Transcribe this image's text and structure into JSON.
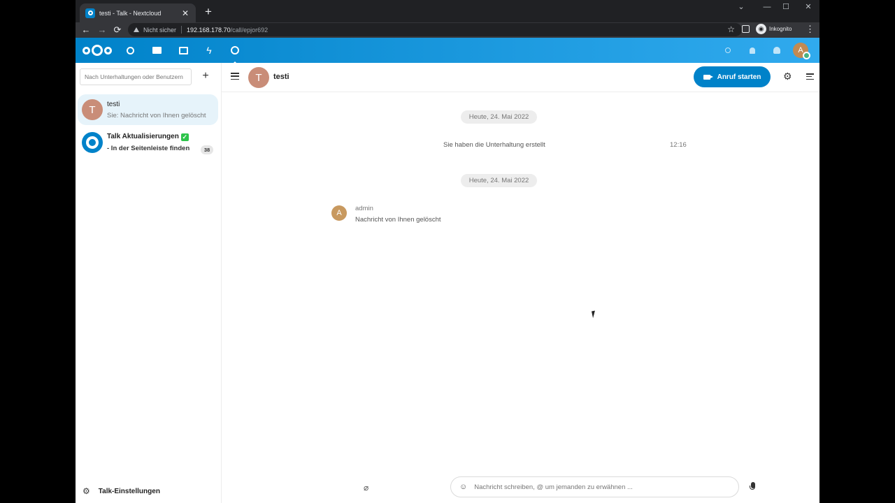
{
  "browser": {
    "tab_title": "testi - Talk - Nextcloud",
    "tab_close": "✕",
    "new_tab": "+",
    "window_controls": [
      "⌄",
      "—",
      "☐",
      "✕"
    ],
    "security_label": "Nicht sicher",
    "url_host": "192.168.178.70",
    "url_path": "/call/epjor692",
    "incognito_label": "Inkognito",
    "nav": {
      "back": "←",
      "forward": "→",
      "reload": "⟳"
    }
  },
  "header": {
    "apps": [
      "dashboard-icon",
      "files-icon",
      "photos-icon",
      "activity-icon",
      "talk-icon"
    ],
    "right": [
      "search-icon",
      "notifications-icon",
      "contacts-icon"
    ],
    "user_initial": "A",
    "accent": "#0082c9"
  },
  "sidebar": {
    "search_placeholder": "Nach Unterhaltungen oder Benutzern",
    "new_conversation": "+",
    "conversations": [
      {
        "name": "testi",
        "subtitle": "Sie: Nachricht von Ihnen gelöscht",
        "initial": "T",
        "active": true
      },
      {
        "name": "Talk Aktualisierungen",
        "subtitle": "- In der Seitenleiste finden",
        "counter": "38",
        "active": false
      }
    ],
    "settings_label": "Talk-Einstellungen"
  },
  "chat": {
    "title": "testi",
    "initial": "T",
    "call_button": "Anruf starten",
    "messages": {
      "date_1": "Heute, 24. Mai 2022",
      "system_message": "Sie haben die Unterhaltung erstellt",
      "system_time": "12:16",
      "date_2": "Heute, 24. Mai 2022",
      "author_initial": "A",
      "author": "admin",
      "body": "Nachricht von Ihnen gelöscht"
    },
    "composer_placeholder": "Nachricht schreiben, @ um jemanden zu erwähnen ..."
  }
}
